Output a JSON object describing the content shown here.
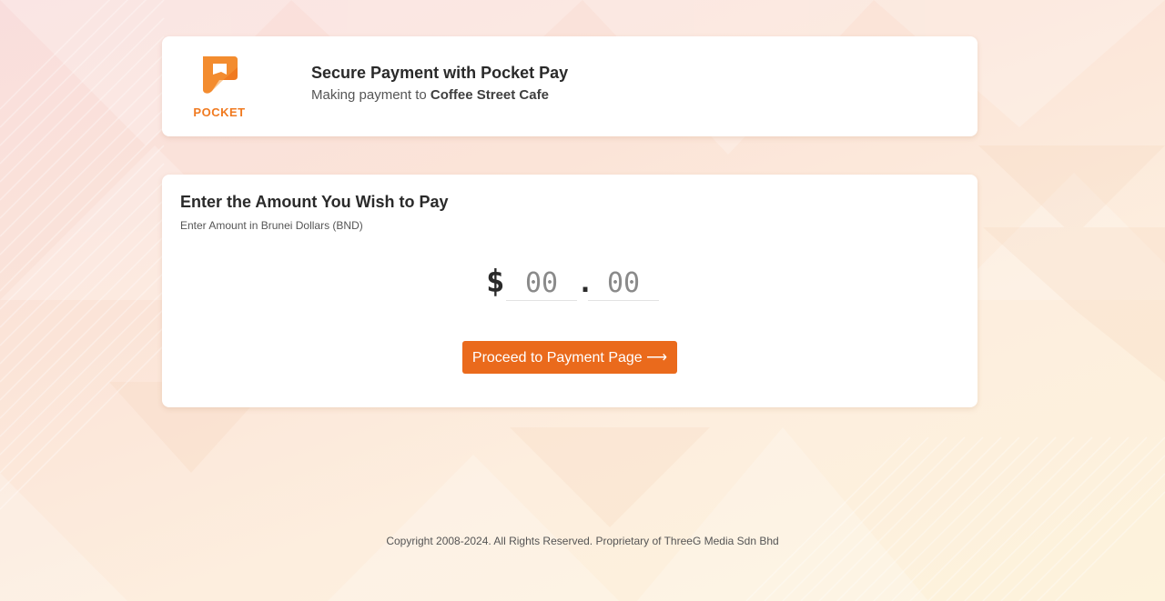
{
  "header": {
    "logo_text": "POCKET",
    "title": "Secure Payment with Pocket Pay",
    "subtitle_prefix": "Making payment to ",
    "merchant": "Coffee Street Cafe"
  },
  "amount_form": {
    "title": "Enter the Amount You Wish to Pay",
    "hint": "Enter Amount in Brunei Dollars (BND)",
    "currency_symbol": "$",
    "whole_placeholder": "00",
    "separator": ".",
    "cents_placeholder": "00",
    "proceed_label": "Proceed to Payment Page ⟶"
  },
  "footer": {
    "copyright": "Copyright 2008-2024. All Rights Reserved. Proprietary of ThreeG Media Sdn Bhd"
  },
  "colors": {
    "brand": "#f07a20",
    "button": "#ea6a1c"
  },
  "icons": {
    "logo": "pocket-logo-icon"
  }
}
